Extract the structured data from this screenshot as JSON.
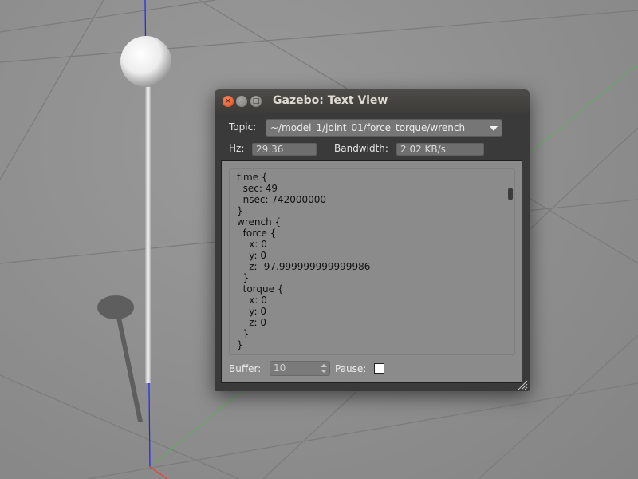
{
  "window": {
    "title": "Gazebo: Text View",
    "controls": [
      "close-icon",
      "minimize-icon",
      "maximize-icon"
    ]
  },
  "topic": {
    "label": "Topic:",
    "value": "~/model_1/joint_01/force_torque/wrench"
  },
  "stats": {
    "hz_label": "Hz:",
    "hz_value": "29.36",
    "bandwidth_label": "Bandwidth:",
    "bandwidth_value": "2.02 KB/s"
  },
  "message_text": "time {\n  sec: 49\n  nsec: 742000000\n}\nwrench {\n  force {\n    x: 0\n    y: 0\n    z: -97.999999999999986\n  }\n  torque {\n    x: 0\n    y: 0\n    z: 0\n  }\n}",
  "footer": {
    "buffer_label": "Buffer:",
    "buffer_value": "10",
    "pause_label": "Pause:",
    "pause_checked": false
  },
  "colors": {
    "accent_close": "#df4a16",
    "axis_z": "#2020ff",
    "axis_y": "#33cc33",
    "axis_x": "#ff3333"
  }
}
